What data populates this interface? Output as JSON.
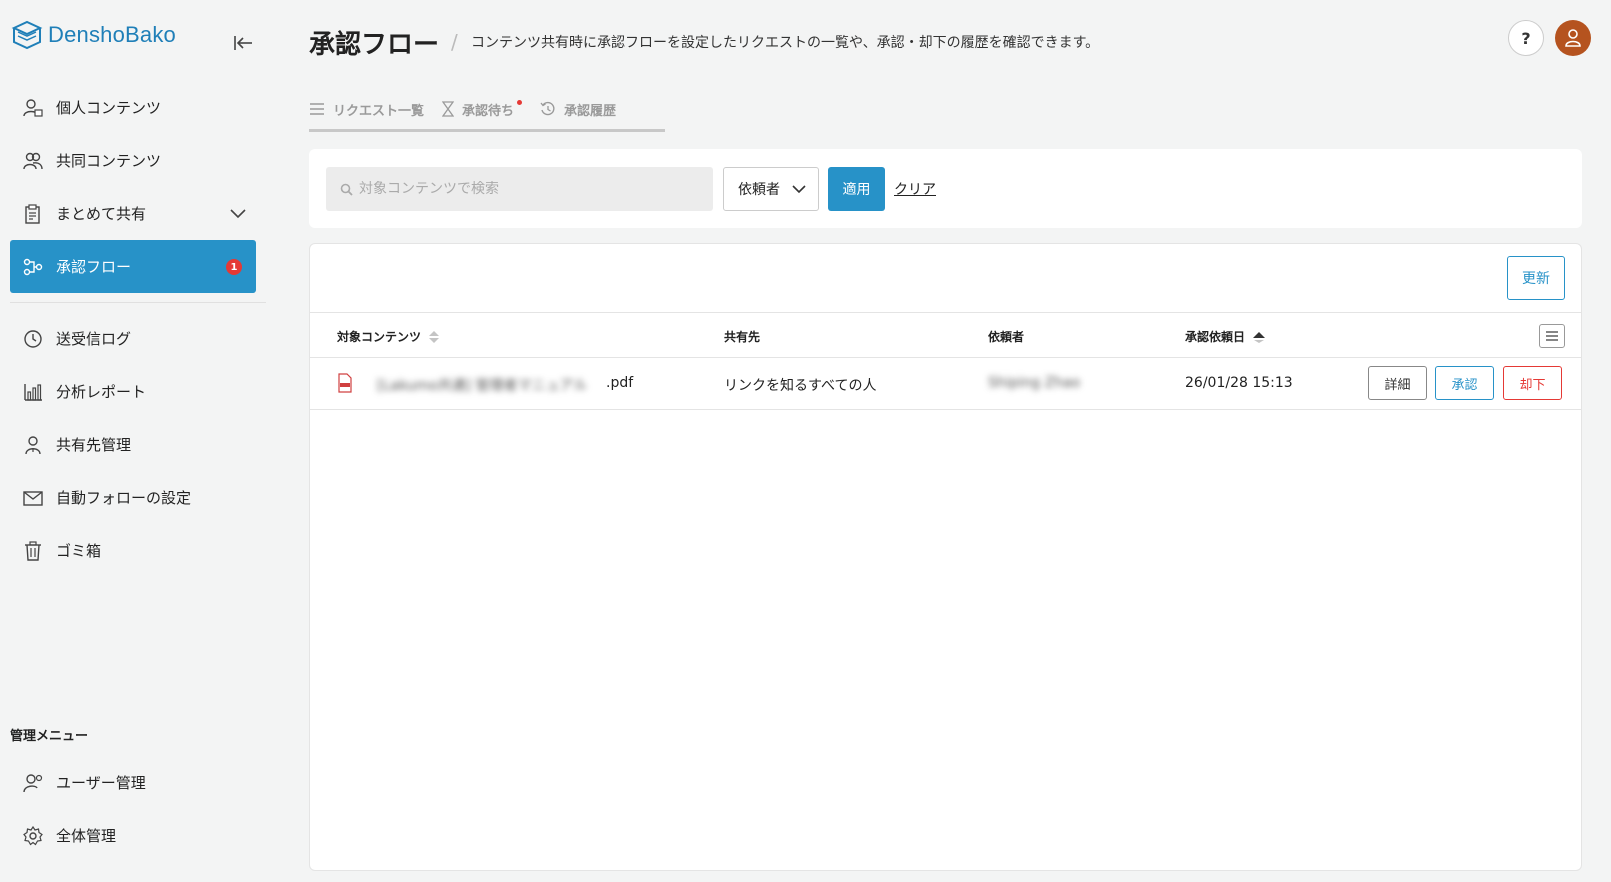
{
  "brand": {
    "name": "DenshoBako",
    "color": "#1f7fb8"
  },
  "sidebar": {
    "items": [
      {
        "label": "個人コンテンツ",
        "icon": "person-lock-icon"
      },
      {
        "label": "共同コンテンツ",
        "icon": "group-icon"
      },
      {
        "label": "まとめて共有",
        "icon": "clipboard-icon"
      },
      {
        "label": "承認フロー",
        "icon": "flow-icon",
        "badge": "1"
      },
      {
        "label": "送受信ログ",
        "icon": "clock-icon"
      },
      {
        "label": "分析レポート",
        "icon": "bar-chart-icon"
      },
      {
        "label": "共有先管理",
        "icon": "person-icon"
      },
      {
        "label": "自動フォローの設定",
        "icon": "mail-icon"
      },
      {
        "label": "ゴミ箱",
        "icon": "trash-icon"
      }
    ],
    "admin_title": "管理メニュー",
    "admin_items": [
      {
        "label": "ユーザー管理",
        "icon": "user-gear-icon"
      },
      {
        "label": "全体管理",
        "icon": "gear-icon"
      }
    ]
  },
  "header": {
    "title": "承認フロー",
    "description": "コンテンツ共有時に承認フローを設定したリクエストの一覧や、承認・却下の履歴を確認できます。",
    "help_label": "?"
  },
  "tabs": [
    {
      "label": "リクエスト一覧",
      "icon": "list-icon"
    },
    {
      "label": "承認待ち",
      "icon": "hourglass-icon"
    },
    {
      "label": "承認履歴",
      "icon": "history-icon"
    }
  ],
  "filter": {
    "search_placeholder": "対象コンテンツで検索",
    "requester_select": "依頼者",
    "apply_label": "適用",
    "clear_label": "クリア"
  },
  "table": {
    "refresh_label": "更新",
    "headers": {
      "content": "対象コンテンツ",
      "share_target": "共有先",
      "requester": "依頼者",
      "request_date": "承認依頼日"
    },
    "rows": [
      {
        "file_name_hidden": "[Lakumo共通] 管理者マニュアル",
        "file_ext": ".pdf",
        "share_target": "リンクを知るすべての人",
        "requester": "Shiping Zhao",
        "request_date": "26/01/28 15:13",
        "detail_label": "詳細",
        "approve_label": "承認",
        "reject_label": "却下"
      }
    ]
  },
  "colors": {
    "accent": "#2792c8",
    "danger": "#e53935",
    "avatar": "#b5531f"
  }
}
